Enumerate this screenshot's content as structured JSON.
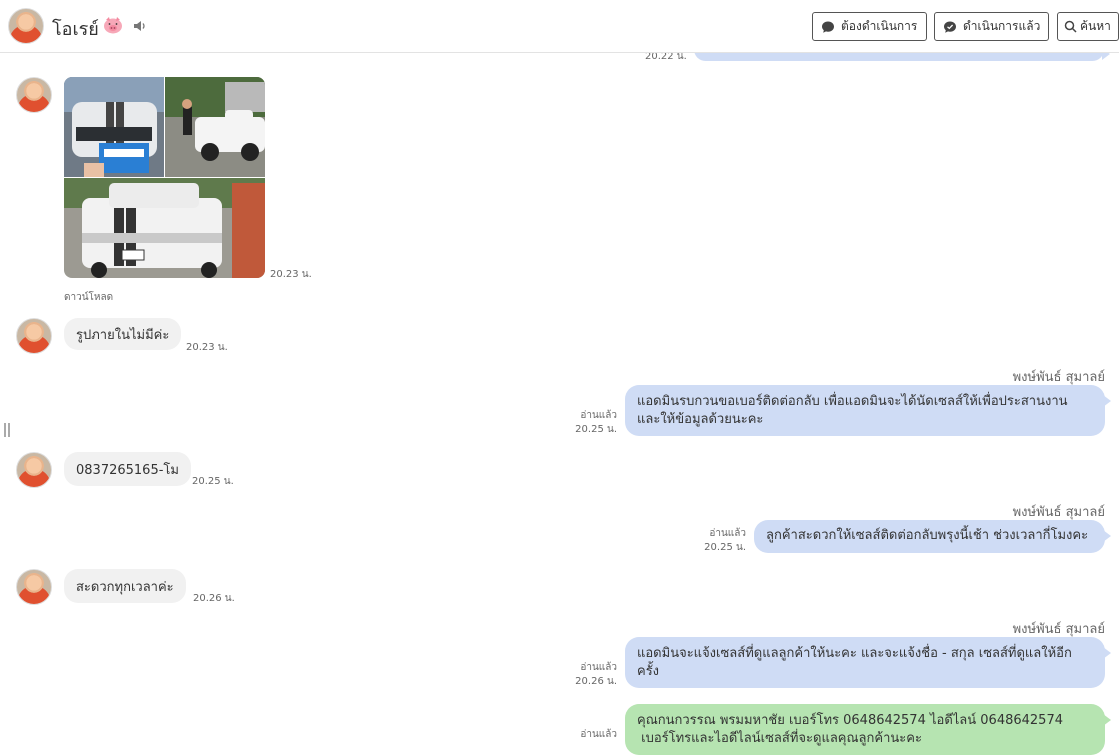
{
  "header": {
    "contact_name": "โอเรย์",
    "icons": {
      "tag": "pig-emoji-icon",
      "sound": "speaker-icon"
    },
    "buttons": {
      "todo_label": "ต้องดำเนินการ",
      "done_label": "ดำเนินการแล้ว",
      "search_label": "ค้นหา"
    }
  },
  "top_partial": {
    "time": "20.22 น."
  },
  "messages": [
    {
      "type": "image",
      "time": "20.23 น.",
      "download_label": "ดาวน์โหลด"
    },
    {
      "type": "text_in",
      "text": "รูปภายในไม่มีค่ะ",
      "time": "20.23 น."
    },
    {
      "type": "text_out",
      "sender": "พงษ์พันธ์ สุมาลย์",
      "lines": [
        "แอดมินรบกวนขอเบอร์ติดต่อกลับ เพื่อแอดมินจะได้นัดเซลส์ให้เพื่อประสานงาน",
        "และให้ข้อมูลด้วยนะคะ"
      ],
      "read": "อ่านแล้ว",
      "time": "20.25 น."
    },
    {
      "type": "text_in",
      "text": "0837265165-โม",
      "time": "20.25 น."
    },
    {
      "type": "text_out",
      "sender": "พงษ์พันธ์ สุมาลย์",
      "lines": [
        "ลูกค้าสะดวกให้เซลส์ติดต่อกลับพรุงนี้เช้า ช่วงเวลากี่โมงคะ"
      ],
      "read": "อ่านแล้ว",
      "time": "20.25 น."
    },
    {
      "type": "text_in",
      "text": "สะดวกทุกเวลาค่ะ",
      "time": "20.26 น."
    },
    {
      "type": "text_out",
      "sender": "พงษ์พันธ์ สุมาลย์",
      "lines": [
        "แอดมินจะแจ้งเซลส์ที่ดูแลลูกค้าให้นะคะ และจะแจ้งชื่อ - สกุล เซลส์ที่ดูแลให้อีก",
        "ครั้ง"
      ],
      "read": "อ่านแล้ว",
      "time": "20.26 น."
    },
    {
      "type": "text_out_green",
      "lines": [
        "คุณกนกวรรณ พรมมหาชัย เบอร์โทร 0648642574 ไอดีไลน์ 0648642574",
        " เบอร์โทรและไอดีไลน์เซลส์ที่จะดูแลคุณลูกค้านะคะ"
      ],
      "read": "อ่านแล้ว"
    }
  ],
  "colors": {
    "bubble_out": "#cfdcf5",
    "bubble_out_green": "#b6e4b1",
    "bubble_in": "#f1f1f1"
  }
}
